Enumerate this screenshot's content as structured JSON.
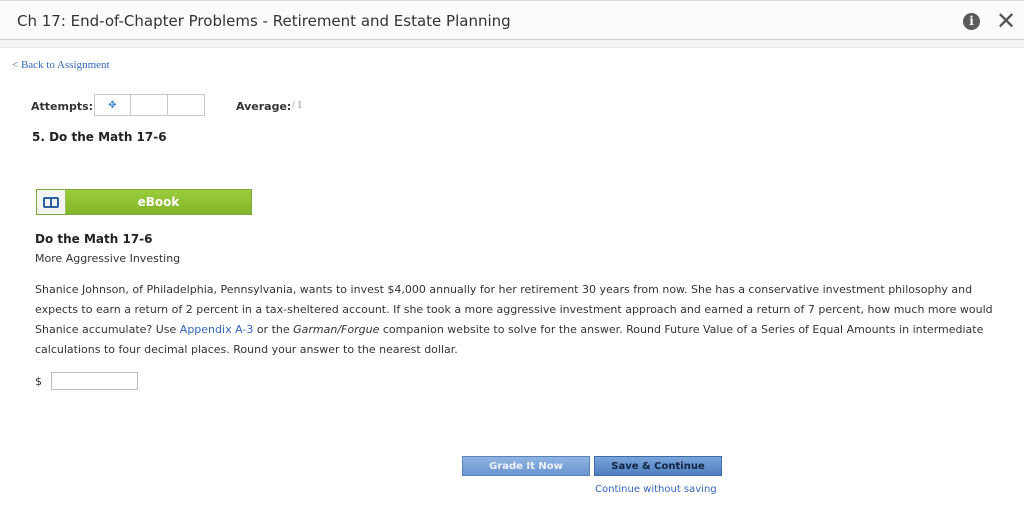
{
  "header": {
    "title": "Ch 17: End-of-Chapter Problems - Retirement and Estate Planning",
    "info_icon_glyph": "i",
    "close_icon_glyph": "✕"
  },
  "nav": {
    "back_label": "< Back to Assignment"
  },
  "attempts": {
    "label": "Attempts:",
    "icon": "diamond-cross-icon"
  },
  "average": {
    "label": "Average:",
    "value": "/ 1"
  },
  "question": {
    "title": "5.  Do the Math 17-6"
  },
  "ebook": {
    "label": "eBook",
    "icon": "book-icon"
  },
  "problem": {
    "heading": "Do the Math 17-6",
    "subheading": "More Aggressive Investing",
    "text_part1": "Shanice Johnson, of Philadelphia, Pennsylvania, wants to invest $4,000 annually for her retirement 30 years from now. She has a conservative investment philosophy and expects to earn a return of 2 percent in a tax-sheltered account. If she took a more aggressive investment approach and earned a return of 7 percent, how much more would Shanice accumulate? Use ",
    "link_text": "Appendix A-3",
    "text_part2": " or the ",
    "italic_text": "Garman/Forgue",
    "text_part3": " companion website to solve for the answer. Round Future Value of a Series of Equal Amounts in intermediate calculations to four decimal places. Round your answer to the nearest dollar."
  },
  "answer": {
    "currency": "$",
    "value": ""
  },
  "actions": {
    "grade_label": "Grade It Now",
    "save_label": "Save & Continue",
    "continue_label": "Continue without saving"
  },
  "colors": {
    "link": "#3366bb",
    "ebook_green": "#8cc63f",
    "button_blue": "#6a95cf"
  }
}
